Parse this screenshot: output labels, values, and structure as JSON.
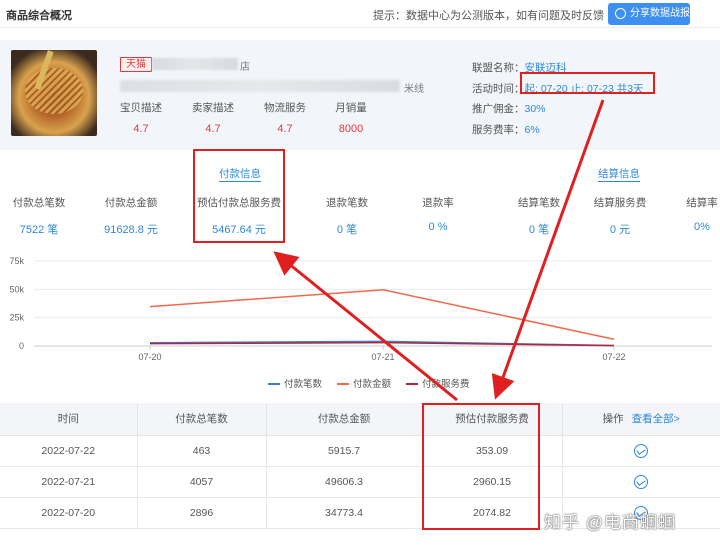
{
  "header": {
    "title": "商品综合概况",
    "tip": "提示：数据中心为公测版本，如有问题及时反馈",
    "share_button": "分享数据战报"
  },
  "product": {
    "platform_badge": "天猫",
    "shop_suffix": "店",
    "name_suffix": "米线",
    "ratings": [
      {
        "label": "宝贝描述",
        "value": "4.7"
      },
      {
        "label": "卖家描述",
        "value": "4.7"
      },
      {
        "label": "物流服务",
        "value": "4.7"
      },
      {
        "label": "月销量",
        "value": "8000"
      }
    ],
    "alliance": [
      {
        "label": "联盟名称：",
        "value": "安联迈科"
      },
      {
        "label": "活动时间：",
        "value": "起: 07-20 止: 07-23 共3天"
      },
      {
        "label": "推广佣金：",
        "value": "30%"
      },
      {
        "label": "服务费率：",
        "value": "6%"
      }
    ]
  },
  "sections": {
    "payment": "付款信息",
    "settlement": "结算信息"
  },
  "stats": [
    {
      "label": "付款总笔数",
      "value": "7522 笔"
    },
    {
      "label": "付款总金额",
      "value": "91628.8 元"
    },
    {
      "label": "预估付款总服务费",
      "value": "5467.64 元"
    },
    {
      "label": "退款笔数",
      "value": "0 笔"
    },
    {
      "label": "退款率",
      "value": "0 %"
    },
    {
      "label": "结算笔数",
      "value": "0 笔"
    },
    {
      "label": "结算服务费",
      "value": "0 元"
    },
    {
      "label": "结算率",
      "value": "0%"
    }
  ],
  "chart_data": {
    "type": "line",
    "categories": [
      "07-20",
      "07-21",
      "07-22"
    ],
    "y_ticks": [
      "0",
      "25k",
      "50k",
      "75k"
    ],
    "ylim": [
      0,
      75000
    ],
    "series": [
      {
        "name": "付款笔数",
        "color": "#3a7fd5",
        "values": [
          2896,
          4057,
          463
        ]
      },
      {
        "name": "付款金额",
        "color": "#f06a4a",
        "values": [
          34773.4,
          49606.3,
          5915.7
        ]
      },
      {
        "name": "付款服务费",
        "color": "#b0273b",
        "values": [
          2074.82,
          2960.15,
          353.09
        ]
      }
    ],
    "grid": true,
    "legend_position": "bottom"
  },
  "table": {
    "headers": [
      "时间",
      "付款总笔数",
      "付款总金额",
      "预估付款服务费",
      "操作"
    ],
    "view_all": "查看全部>",
    "rows": [
      [
        "2022-07-22",
        "463",
        "5915.7",
        "353.09"
      ],
      [
        "2022-07-21",
        "4057",
        "49606.3",
        "2960.15"
      ],
      [
        "2022-07-20",
        "2896",
        "34773.4",
        "2074.82"
      ]
    ]
  },
  "watermark": "知乎 @电商蝈蝈",
  "annotation_color": "#e02020"
}
